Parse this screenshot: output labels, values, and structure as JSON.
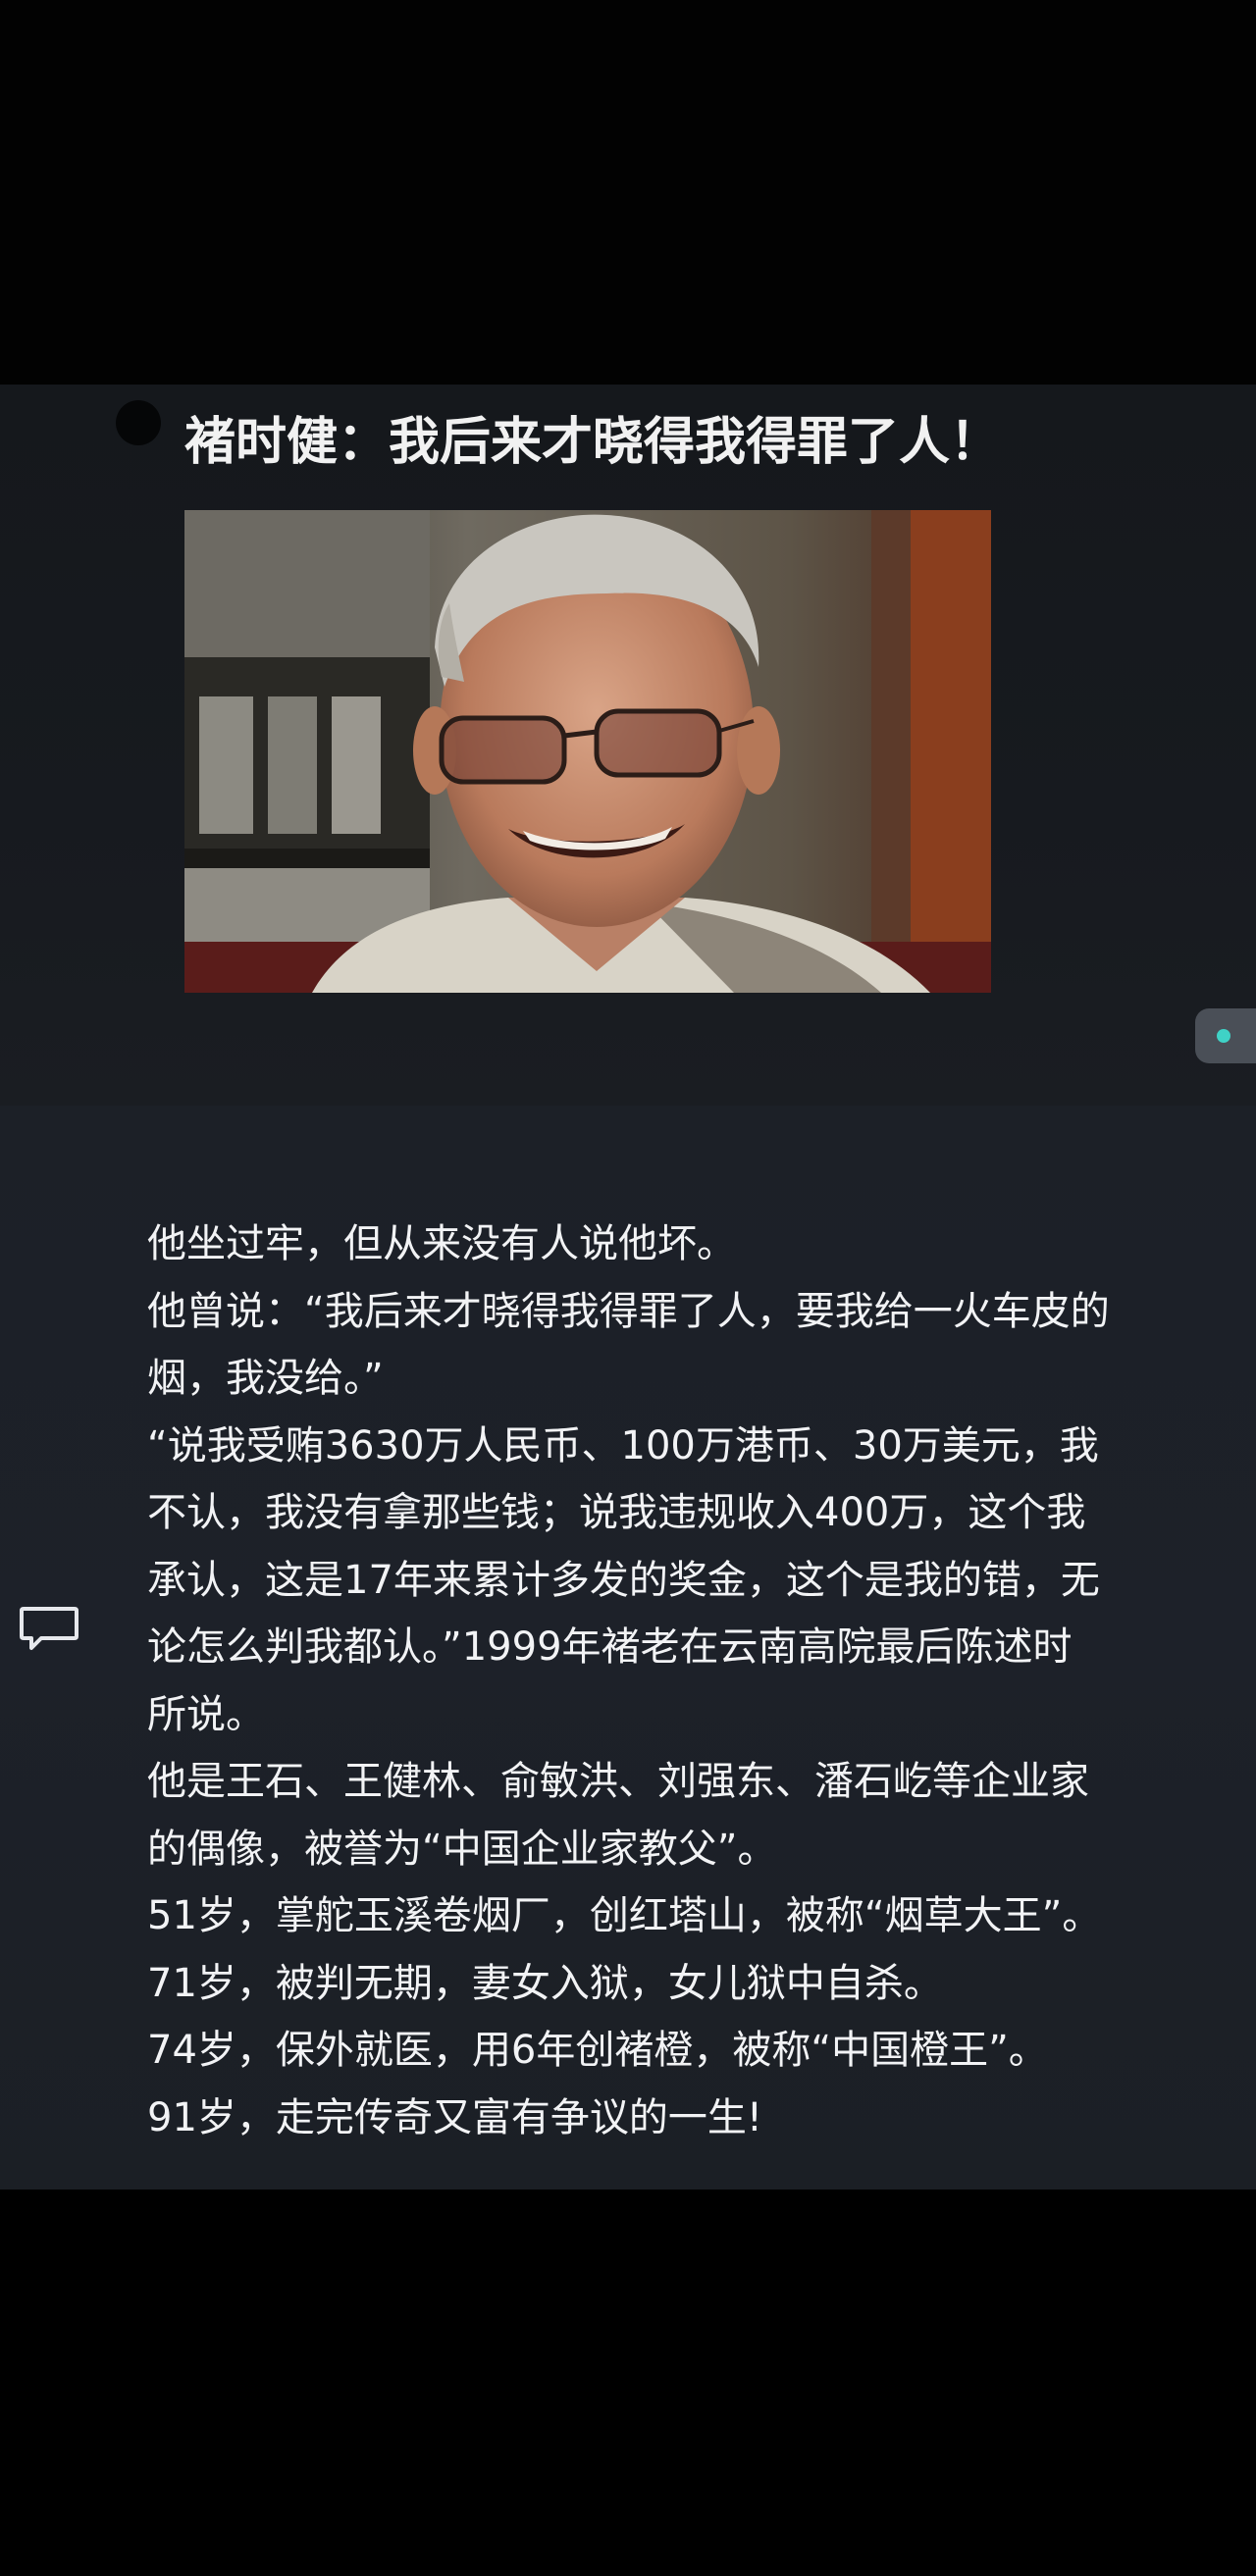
{
  "video": {
    "title": "褚时健：我后来才晓得我得罪了人！",
    "photo_icon": "portrait-photo"
  },
  "side_indicator": {
    "accent": "#3fd2c6"
  },
  "comment_icon": "speech-bubble-icon",
  "article": {
    "lines": [
      "他坐过牢，但从来没有人说他坏。",
      "他曾说：“我后来才晓得我得罪了人，要我给一火车皮的",
      "烟，我没给。”",
      "“说我受贿3630万人民币、100万港币、30万美元，我",
      "不认，我没有拿那些钱；说我违规收入400万，这个我",
      "承认，这是17年来累计多发的奖金，这个是我的错，无",
      "论怎么判我都认。”1999年褚老在云南高院最后陈述时",
      "所说。",
      "他是王石、王健林、俞敏洪、刘强东、潘石屹等企业家",
      "的偶像，被誉为“中国企业家教父”。",
      "51岁，掌舵玉溪卷烟厂，创红塔山，被称“烟草大王”。",
      "71岁，被判无期，妻女入狱，女儿狱中自杀。",
      "74岁，保外就医，用6年创褚橙，被称“中国橙王”。",
      "91岁，走完传奇又富有争议的一生!"
    ]
  }
}
